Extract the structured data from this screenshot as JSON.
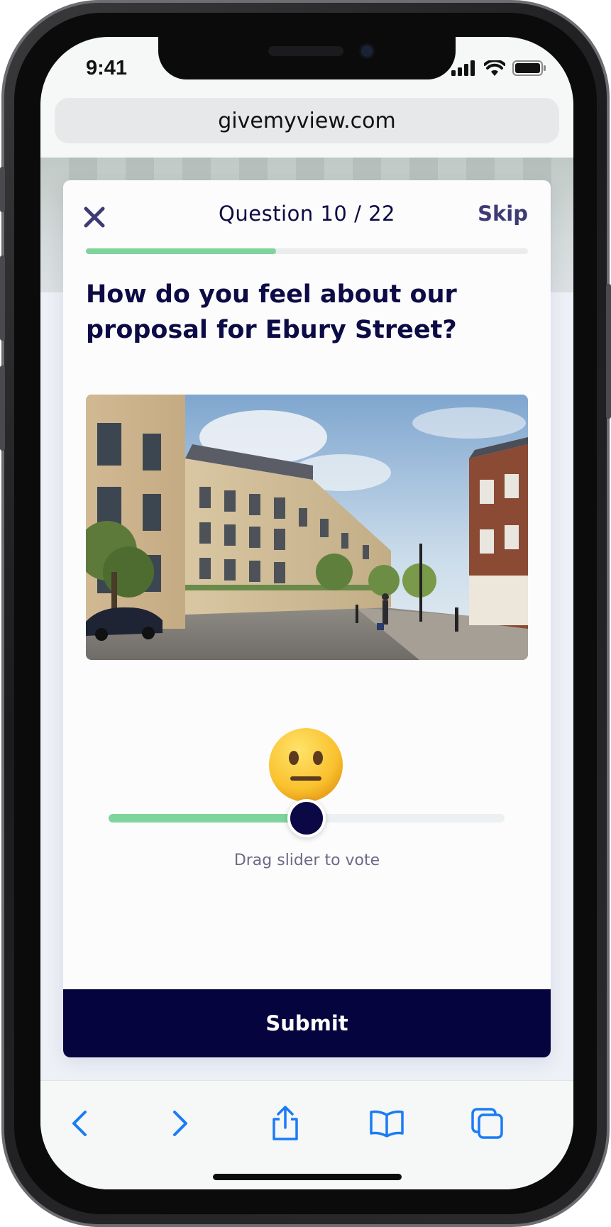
{
  "status_bar": {
    "time": "9:41",
    "icons": [
      "cellular-signal-icon",
      "wifi-icon",
      "battery-icon"
    ]
  },
  "browser": {
    "url": "givemyview.com",
    "toolbar": [
      "back-icon",
      "forward-icon",
      "share-icon",
      "bookmarks-icon",
      "tabs-icon"
    ]
  },
  "survey": {
    "close_icon": "close-icon",
    "question_count": "Question 10 / 22",
    "skip_label": "Skip",
    "progress": 0.43,
    "question_text": "How do you feel about our proposal for Ebury Street?",
    "image_subject": "Ebury Street proposal rendering",
    "sentiment_emoji": "neutral-face-icon",
    "slider_value": 0.5,
    "slider_hint": "Drag slider to vote",
    "submit_label": "Submit"
  },
  "colors": {
    "primary": "#06043f",
    "accent_green": "#7fd49c",
    "text_dark": "#0d0b45",
    "ios_blue": "#1a7cf5"
  }
}
